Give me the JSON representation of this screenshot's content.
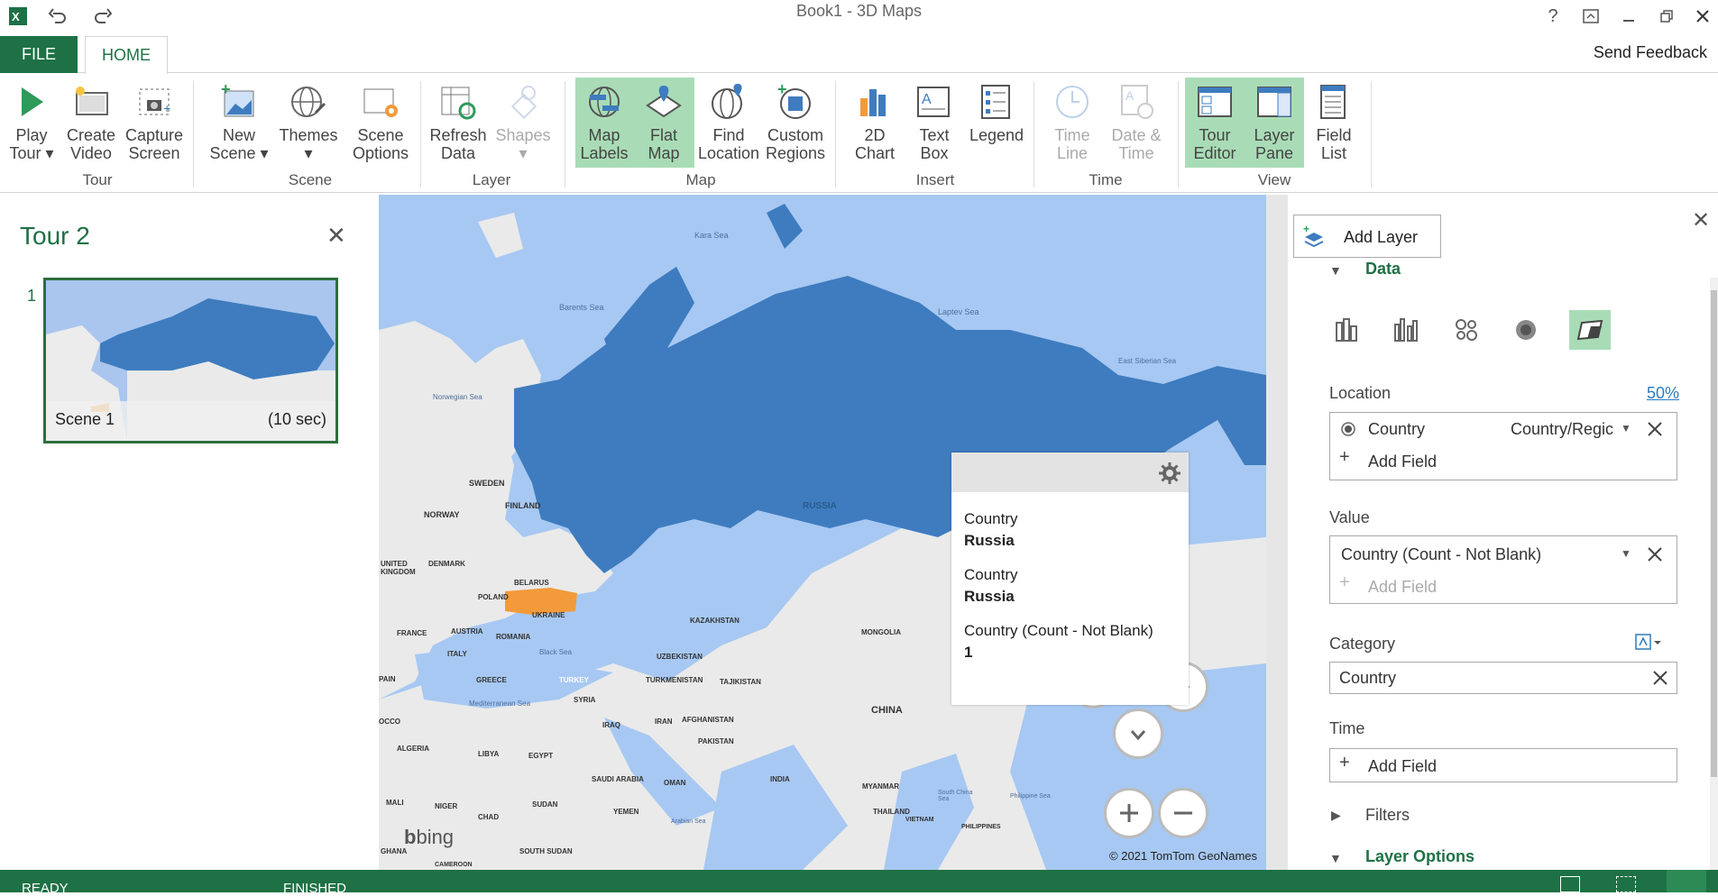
{
  "window": {
    "title": "Book1 - 3D Maps"
  },
  "tabs": {
    "file": "FILE",
    "home": "HOME"
  },
  "send_feedback": "Send Feedback",
  "ribbon": {
    "play_tour": [
      "Play",
      "Tour"
    ],
    "create_video": [
      "Create",
      "Video"
    ],
    "capture_screen": [
      "Capture",
      "Screen"
    ],
    "new_scene": [
      "New",
      "Scene"
    ],
    "themes": [
      "Themes",
      ""
    ],
    "scene_options": [
      "Scene",
      "Options"
    ],
    "refresh_data": [
      "Refresh",
      "Data"
    ],
    "shapes": [
      "Shapes",
      ""
    ],
    "map_labels": [
      "Map",
      "Labels"
    ],
    "flat_map": [
      "Flat",
      "Map"
    ],
    "find_location": [
      "Find",
      "Location"
    ],
    "custom_regions": [
      "Custom",
      "Regions"
    ],
    "chart_2d": [
      "2D",
      "Chart"
    ],
    "text_box": [
      "Text",
      "Box"
    ],
    "legend": [
      "Legend",
      ""
    ],
    "time_line": [
      "Time",
      "Line"
    ],
    "date_time": [
      "Date &",
      "Time"
    ],
    "tour_editor": [
      "Tour",
      "Editor"
    ],
    "layer_pane": [
      "Layer",
      "Pane"
    ],
    "field_list": [
      "Field",
      "List"
    ],
    "groups": {
      "tour": "Tour",
      "scene": "Scene",
      "layer": "Layer",
      "map": "Map",
      "insert": "Insert",
      "time": "Time",
      "view": "View"
    }
  },
  "tour_panel": {
    "title": "Tour 2",
    "scene_number": "1",
    "scene_name": "Scene 1",
    "scene_duration": "(10 sec)"
  },
  "map": {
    "labels": {
      "kara_sea": "Kara Sea",
      "barents_sea": "Barents Sea",
      "laptev_sea": "Laptev Sea",
      "east_siberian_sea": "East Siberian Sea",
      "norwegian_sea": "Norwegian Sea",
      "sweden": "SWEDEN",
      "finland": "FINLAND",
      "norway": "NORWAY",
      "russia": "RUSSIA",
      "united_kingdom": "UNITED KINGDOM",
      "denmark": "DENMARK",
      "belarus": "BELARUS",
      "poland": "POLAND",
      "ukraine": "UKRAINE",
      "france": "FRANCE",
      "austria": "AUSTRIA",
      "romania": "ROMANIA",
      "kazakhstan": "KAZAKHSTAN",
      "mongolia": "MONGOLIA",
      "italy": "ITALY",
      "black_sea": "Black Sea",
      "uzbekistan": "UZBEKISTAN",
      "spain": "PAIN",
      "greece": "GREECE",
      "turkey": "TURKEY",
      "turkmenistan": "TURKMENISTAN",
      "tajikistan": "TAJIKISTAN",
      "mediterranean_sea": "Mediterranean Sea",
      "syria": "SYRIA",
      "china": "CHINA",
      "morocco": "OCCO",
      "iraq": "IRAQ",
      "iran": "IRAN",
      "afghanistan": "AFGHANISTAN",
      "pakistan": "PAKISTAN",
      "algeria": "ALGERIA",
      "libya": "LIBYA",
      "egypt": "EGYPT",
      "saudi_arabia": "SAUDI ARABIA",
      "oman": "OMAN",
      "india": "INDIA",
      "myanmar": "MYANMAR",
      "south_china_sea": "South China Sea",
      "philippine_sea": "Philippine Sea",
      "mali": "MALI",
      "niger": "NIGER",
      "chad": "CHAD",
      "sudan": "SUDAN",
      "yemen": "YEMEN",
      "arabian_sea": "Arabian Sea",
      "thailand": "THAILAND",
      "vietnam": "VIETNAM",
      "philippines": "PHILIPPINES",
      "ghana": "GHANA",
      "south_sudan": "SOUTH SUDAN",
      "cameroon": "CAMEROON"
    },
    "bing": "bing",
    "copyright": "© 2021 TomTom  GeoNames",
    "highlight_color": "#3e7cbf",
    "category_color": "#f39a3a"
  },
  "popup": {
    "label1": "Country",
    "value1": "Russia",
    "label2": "Country",
    "value2": "Russia",
    "label3": "Country (Count - Not Blank)",
    "value3": "1"
  },
  "layer_pane": {
    "add_layer": "Add Layer",
    "data_section": "Data",
    "location_label": "Location",
    "location_pct": "50%",
    "location_field": "Country",
    "location_type": "Country/Regic",
    "add_field": "Add Field",
    "value_label": "Value",
    "value_field": "Country (Count - Not Blank)",
    "category_label": "Category",
    "category_field": "Country",
    "time_label": "Time",
    "filters": "Filters",
    "layer_options": "Layer Options"
  },
  "status": {
    "ready": "READY",
    "finished": "FINISHED"
  }
}
